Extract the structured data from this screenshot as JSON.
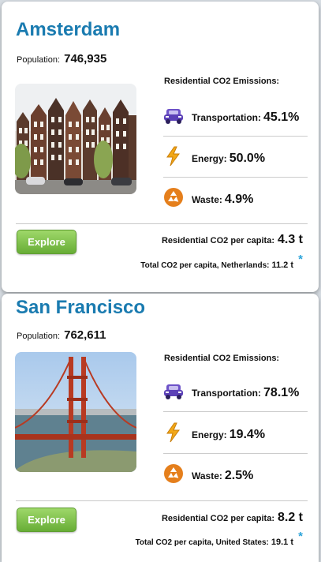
{
  "cities": [
    {
      "name": "Amsterdam",
      "population_label": "Population:",
      "population": "746,935",
      "emissions_heading": "Residential CO2 Emissions:",
      "rows": [
        {
          "label": "Transportation:",
          "value": "45.1%",
          "icon": "car-icon"
        },
        {
          "label": "Energy:",
          "value": "50.0%",
          "icon": "lightning-icon"
        },
        {
          "label": "Waste:",
          "value": "4.9%",
          "icon": "recycle-icon"
        }
      ],
      "explore_label": "Explore",
      "per_capita_label": "Residential CO2 per capita:",
      "per_capita_value": "4.3 t",
      "total_label": "Total CO2 per capita, Netherlands:",
      "total_value": "11.2 t",
      "footnote_marker": "*"
    },
    {
      "name": "San Francisco",
      "population_label": "Population:",
      "population": "762,611",
      "emissions_heading": "Residential CO2 Emissions:",
      "rows": [
        {
          "label": "Transportation:",
          "value": "78.1%",
          "icon": "car-icon"
        },
        {
          "label": "Energy:",
          "value": "19.4%",
          "icon": "lightning-icon"
        },
        {
          "label": "Waste:",
          "value": "2.5%",
          "icon": "recycle-icon"
        }
      ],
      "explore_label": "Explore",
      "per_capita_label": "Residential CO2 per capita:",
      "per_capita_value": "8.2 t",
      "total_label": "Total CO2 per capita, United States:",
      "total_value": "19.1 t",
      "footnote_marker": "*"
    }
  ],
  "colors": {
    "city_title": "#1a7bb0",
    "button_green": "#67ad36",
    "footnote": "#2ba3d9",
    "car_icon": "#6d52c8",
    "lightning_icon": "#f2a818",
    "recycle_icon": "#e57f1c"
  }
}
